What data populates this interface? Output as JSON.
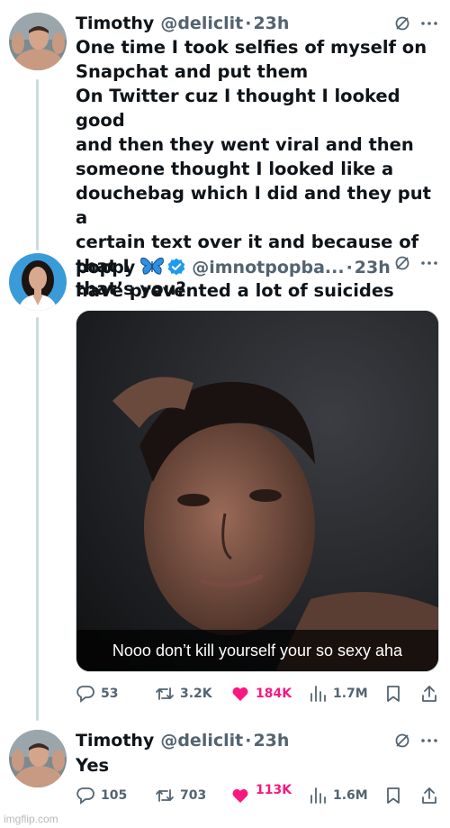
{
  "theme": {
    "text": "#0f1419",
    "muted": "#536471",
    "like": "#f91880",
    "verified": "#1d9bf0",
    "thread_line": "#cfd9de"
  },
  "tweets": [
    {
      "name": "Timothy",
      "handle": "@deliclit",
      "dot": "·",
      "time": "23h",
      "text": "One time I took selfies of myself on\nSnapchat and put them\nOn Twitter cuz I thought I looked good\nand then they went viral and then\nsomeone thought I looked like a\ndouchebag which I did and they put a\ncertain text over it and because of that I\nhave prevented a lot of suicides"
    },
    {
      "name": "poppy",
      "emoji": "blue-butterfly-emoji",
      "verified": true,
      "handle": "@imnotpopba...",
      "dot": "·",
      "time": "23h",
      "text": "that’s you?",
      "media_caption": "Nooo don’t kill yourself your so sexy aha",
      "stats": {
        "replies": "53",
        "retweets": "3.2K",
        "likes": "184K",
        "views": "1.7M"
      }
    },
    {
      "name": "Timothy",
      "handle": "@deliclit",
      "dot": "·",
      "time": "23h",
      "text": "Yes",
      "stats": {
        "replies": "105",
        "retweets": "703",
        "likes": "113K",
        "views": "1.6M"
      }
    }
  ],
  "watermark": "imgflip.com"
}
